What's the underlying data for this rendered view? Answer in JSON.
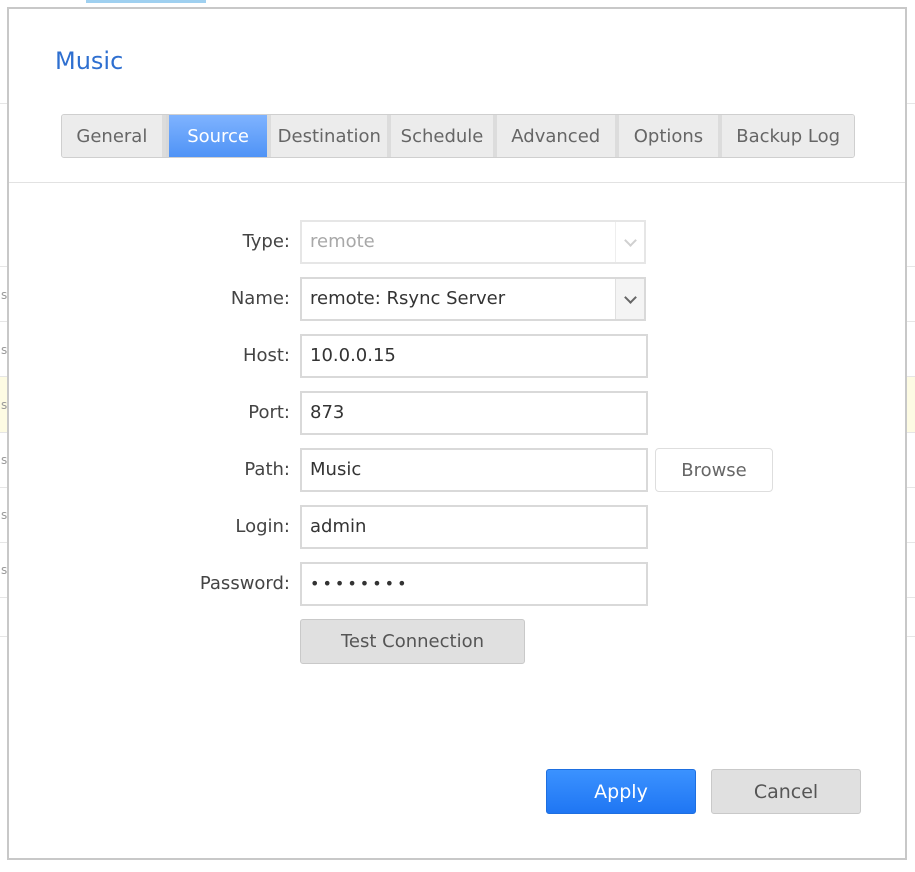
{
  "dialog": {
    "title": "Music",
    "tabs": [
      {
        "label": "General"
      },
      {
        "label": "Source"
      },
      {
        "label": "Destination"
      },
      {
        "label": "Schedule"
      },
      {
        "label": "Advanced"
      },
      {
        "label": "Options"
      },
      {
        "label": "Backup Log"
      }
    ],
    "active_tab": "Source"
  },
  "form": {
    "type": {
      "label": "Type:",
      "value": "remote"
    },
    "name": {
      "label": "Name:",
      "value": "remote: Rsync Server"
    },
    "host": {
      "label": "Host:",
      "value": "10.0.0.15"
    },
    "port": {
      "label": "Port:",
      "value": "873"
    },
    "path": {
      "label": "Path:",
      "value": "Music",
      "browse_label": "Browse"
    },
    "login": {
      "label": "Login:",
      "value": "admin"
    },
    "password": {
      "label": "Password:",
      "value": "••••••••"
    },
    "test_label": "Test Connection"
  },
  "footer": {
    "apply_label": "Apply",
    "cancel_label": "Cancel"
  },
  "colors": {
    "accent": "#1f76f3",
    "title": "#2e6fd0",
    "active_tab": "#5a9bf8"
  },
  "background": {
    "row_glyphs": [
      "s",
      "s",
      "s",
      "s",
      "s",
      "s"
    ]
  }
}
